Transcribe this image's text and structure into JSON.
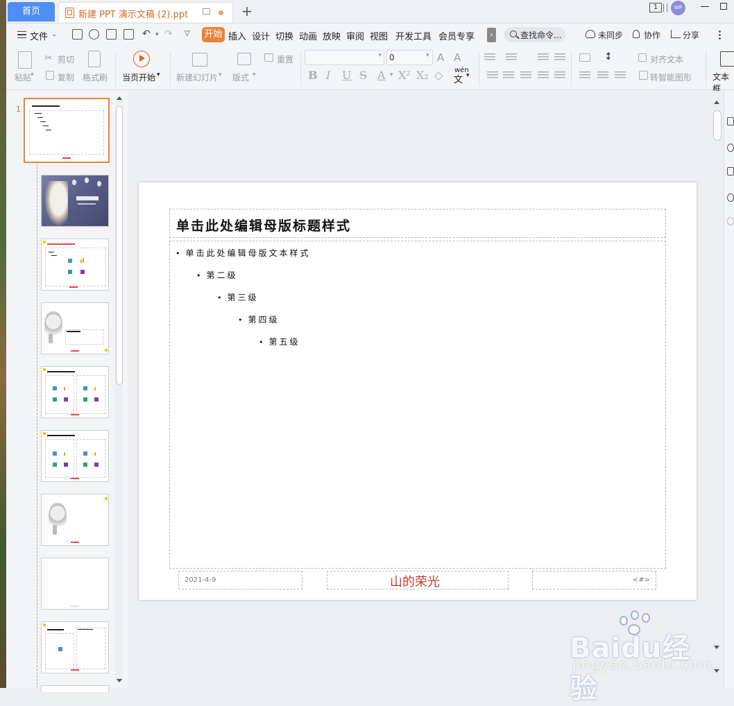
{
  "tabs": {
    "home": "首页",
    "document": "新建 PPT 演示文稿 (2).ppt",
    "new_tab": "+"
  },
  "window": {
    "page_count": "1",
    "avatar": "WP"
  },
  "menubar": {
    "file": "文件",
    "items": [
      "开始",
      "插入",
      "设计",
      "切换",
      "动画",
      "放映",
      "审阅",
      "视图",
      "开发工具",
      "会员专享"
    ],
    "more": "›",
    "search": "查找命令...",
    "sync": "未同步",
    "collab": "协作",
    "share": "分享"
  },
  "ribbon": {
    "paste": "粘贴",
    "cut": "剪切",
    "copy": "复制",
    "format_painter": "格式刷",
    "start_from_current": "当页开始",
    "new_slide": "新建幻灯片",
    "layout": "版式",
    "reset": "重置",
    "font_name": "",
    "font_size": "0",
    "align_text": "对齐文本",
    "to_smartart": "转智能图形",
    "textbox": "文本框",
    "wen": "wén"
  },
  "thumbnails": {
    "selected_number": "1",
    "count": 10
  },
  "slide": {
    "title": "单击此处编辑母版标题样式",
    "bullet": "•",
    "levels": [
      "单击此处编辑母版文本样式",
      "第二级",
      "第三级",
      "第四级",
      "第五级"
    ],
    "footer_date": "2021-4-9",
    "footer_text": "山的荣光",
    "footer_number": "<#>"
  },
  "watermark": {
    "brand": "Baidu经验",
    "site": "jingyan.baidu.com"
  },
  "colors": {
    "accent": "#e8843a",
    "home_tab": "#4f8ef7",
    "footer_red": "#c43c2c"
  }
}
